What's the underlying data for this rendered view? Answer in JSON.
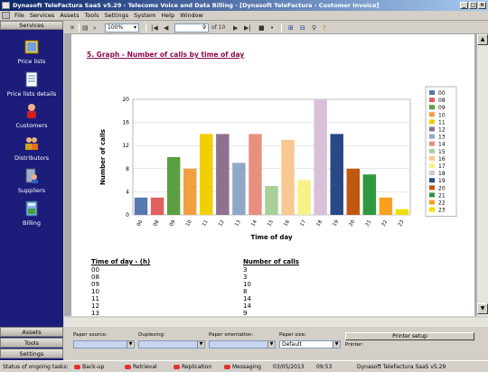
{
  "window": {
    "title": "Dynasoft TeleFactura SaaS v5.29 - Telecoms Voice and Data Billing - [Dynasoft TeleFactura - Customer Invoice]"
  },
  "menu": [
    "File",
    "Services",
    "Assets",
    "Tools",
    "Settings",
    "System",
    "Help",
    "Window"
  ],
  "sidebar": {
    "header": "Services",
    "items": [
      {
        "label": "Price lists",
        "icon": "book-icon"
      },
      {
        "label": "Price lists details",
        "icon": "document-list-icon"
      },
      {
        "label": "Customers",
        "icon": "person-icon"
      },
      {
        "label": "Distributors",
        "icon": "people-icon"
      },
      {
        "label": "Suppliers",
        "icon": "server-people-icon"
      },
      {
        "label": "Billing",
        "icon": "calculator-icon"
      }
    ],
    "footer": [
      "Assets",
      "Tools",
      "Settings"
    ]
  },
  "toolbar": {
    "zoom": "100%",
    "page": "9",
    "of": "of 10"
  },
  "report": {
    "section_title": "5. Graph - Number of calls by time of day",
    "table_headers": [
      "Time of day - (h)",
      "Number of calls"
    ],
    "rows": [
      [
        "00",
        "3"
      ],
      [
        "08",
        "3"
      ],
      [
        "09",
        "10"
      ],
      [
        "10",
        "8"
      ],
      [
        "11",
        "14"
      ],
      [
        "12",
        "14"
      ],
      [
        "13",
        "9"
      ]
    ]
  },
  "chart_data": {
    "type": "bar",
    "categories": [
      "00",
      "08",
      "09",
      "10",
      "11",
      "12",
      "13",
      "14",
      "15",
      "16",
      "17",
      "18",
      "19",
      "20",
      "21",
      "22",
      "23"
    ],
    "values": [
      3,
      3,
      10,
      8,
      14,
      14,
      9,
      14,
      5,
      13,
      6,
      20,
      14,
      8,
      7,
      3,
      1
    ],
    "colors": [
      "#5878b0",
      "#e06060",
      "#5aa040",
      "#f0a040",
      "#f0d000",
      "#907090",
      "#90a8c8",
      "#e89080",
      "#a8d098",
      "#f8c890",
      "#f8f088",
      "#d8c0d8",
      "#284888",
      "#c05810",
      "#309840",
      "#f8a020",
      "#f0e000"
    ],
    "ylim": [
      0,
      20
    ],
    "yticks": [
      0,
      4,
      8,
      12,
      16,
      20
    ],
    "xlabel": "Time of day",
    "ylabel": "Number of calls",
    "legend": "right"
  },
  "print": {
    "paper_source": "Paper source:",
    "duplexing": "Duplexing:",
    "orientation": "Paper orientation:",
    "size_label": "Paper size:",
    "size_value": "Default",
    "setup": "Printer setup",
    "printer": "Printer:"
  },
  "status": {
    "label": "Status of ongoing tasks:",
    "tasks": [
      "Back-up",
      "Retrieval",
      "Replication",
      "Messaging"
    ],
    "date": "03/05/2013",
    "time": "09:53",
    "version": "Dynasoft TeleFactura SaaS v5.29"
  }
}
